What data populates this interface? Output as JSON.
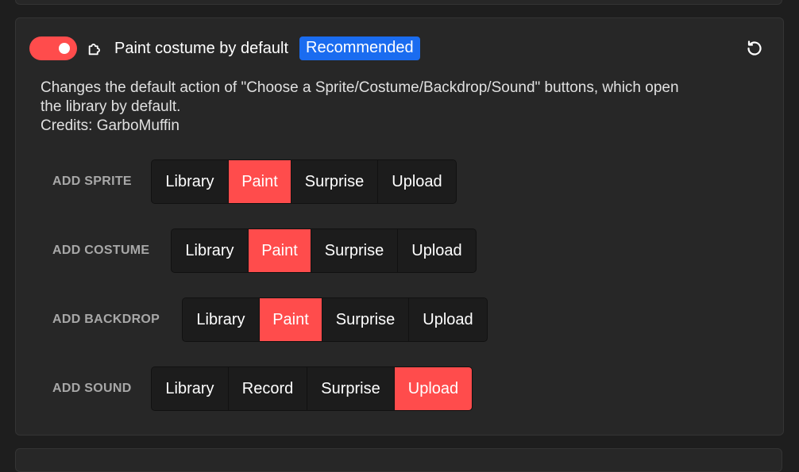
{
  "addon": {
    "title": "Paint costume by default",
    "badge": "Recommended",
    "enabled": true,
    "description_line1": "Changes the default action of \"Choose a Sprite/Costume/Backdrop/Sound\" buttons, which open",
    "description_line2": "the library by default.",
    "credits": "Credits: GarboMuffin",
    "accent_color": "#ff4c4c",
    "badge_color": "#1a6cf0"
  },
  "settings": [
    {
      "label": "ADD SPRITE",
      "options": [
        "Library",
        "Paint",
        "Surprise",
        "Upload"
      ],
      "selected": "Paint"
    },
    {
      "label": "ADD COSTUME",
      "options": [
        "Library",
        "Paint",
        "Surprise",
        "Upload"
      ],
      "selected": "Paint"
    },
    {
      "label": "ADD BACKDROP",
      "options": [
        "Library",
        "Paint",
        "Surprise",
        "Upload"
      ],
      "selected": "Paint"
    },
    {
      "label": "ADD SOUND",
      "options": [
        "Library",
        "Record",
        "Surprise",
        "Upload"
      ],
      "selected": "Upload"
    }
  ],
  "icons": {
    "toggle": "toggle-switch",
    "addon": "puzzle-icon",
    "reset": "reset-icon"
  }
}
